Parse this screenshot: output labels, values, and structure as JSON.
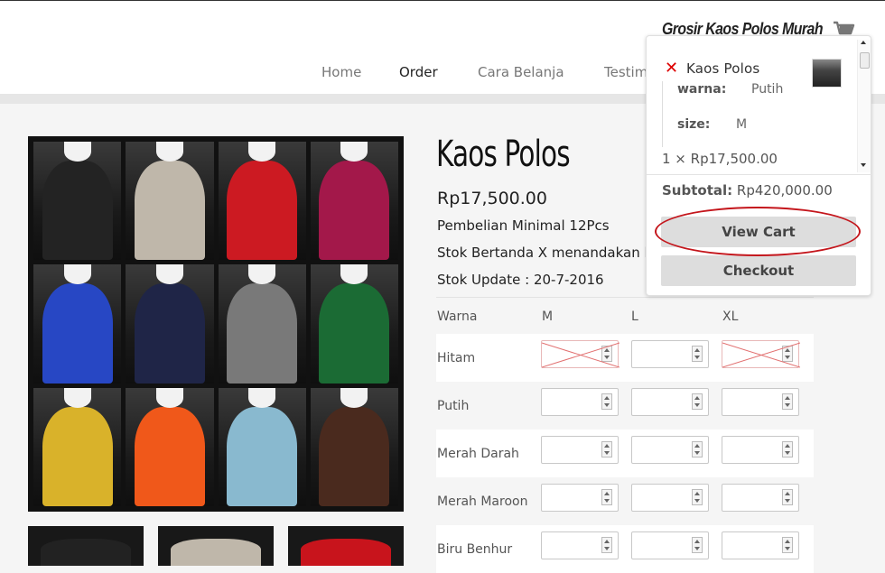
{
  "header": {
    "brand": "Grosir Kaos Polos Murah",
    "cart_icon": "shopping-cart-icon",
    "nav": [
      {
        "label": "Home",
        "active": false
      },
      {
        "label": "Order",
        "active": true
      },
      {
        "label": "Cara Belanja",
        "active": false
      },
      {
        "label": "Testim",
        "active": false
      }
    ]
  },
  "product": {
    "name": "Kaos Polos",
    "price": "Rp17,500.00",
    "info": [
      "Pembelian Minimal 12Pcs",
      "Stok Bertanda X menandakan lag",
      "Stok Update : 20-7-2016"
    ],
    "gallery_colors": [
      "#232323",
      "#bfb7aa",
      "#cc1a22",
      "#a3184a",
      "#2747c4",
      "#1f2547",
      "#797979",
      "#1b6b34",
      "#d9b22a",
      "#f0581a",
      "#89b9cf",
      "#4a2a1e"
    ],
    "thumb_colors": [
      "#222222",
      "#bfb7aa",
      "#c8141c"
    ],
    "variant_table": {
      "label_header": "Warna",
      "sizes": [
        "M",
        "L",
        "XL"
      ],
      "rows": [
        {
          "color": "Hitam",
          "disabled": [
            true,
            false,
            true
          ]
        },
        {
          "color": "Putih",
          "disabled": [
            false,
            false,
            false
          ]
        },
        {
          "color": "Merah Darah",
          "disabled": [
            false,
            false,
            false
          ]
        },
        {
          "color": "Merah Maroon",
          "disabled": [
            false,
            false,
            false
          ]
        },
        {
          "color": "Biru Benhur",
          "disabled": [
            false,
            false,
            false
          ]
        }
      ]
    }
  },
  "mini_cart": {
    "item": {
      "title": "Kaos Polos",
      "remove_icon": "remove-x-icon",
      "meta": [
        {
          "key": "warna:",
          "value": "Putih"
        },
        {
          "key": "size:",
          "value": "M"
        }
      ],
      "qty_line": "1 × Rp17,500.00"
    },
    "subtotal_label": "Subtotal:",
    "subtotal_value": "Rp420,000.00",
    "view_cart": "View Cart",
    "checkout": "Checkout",
    "highlight_color": "#c4161c"
  }
}
